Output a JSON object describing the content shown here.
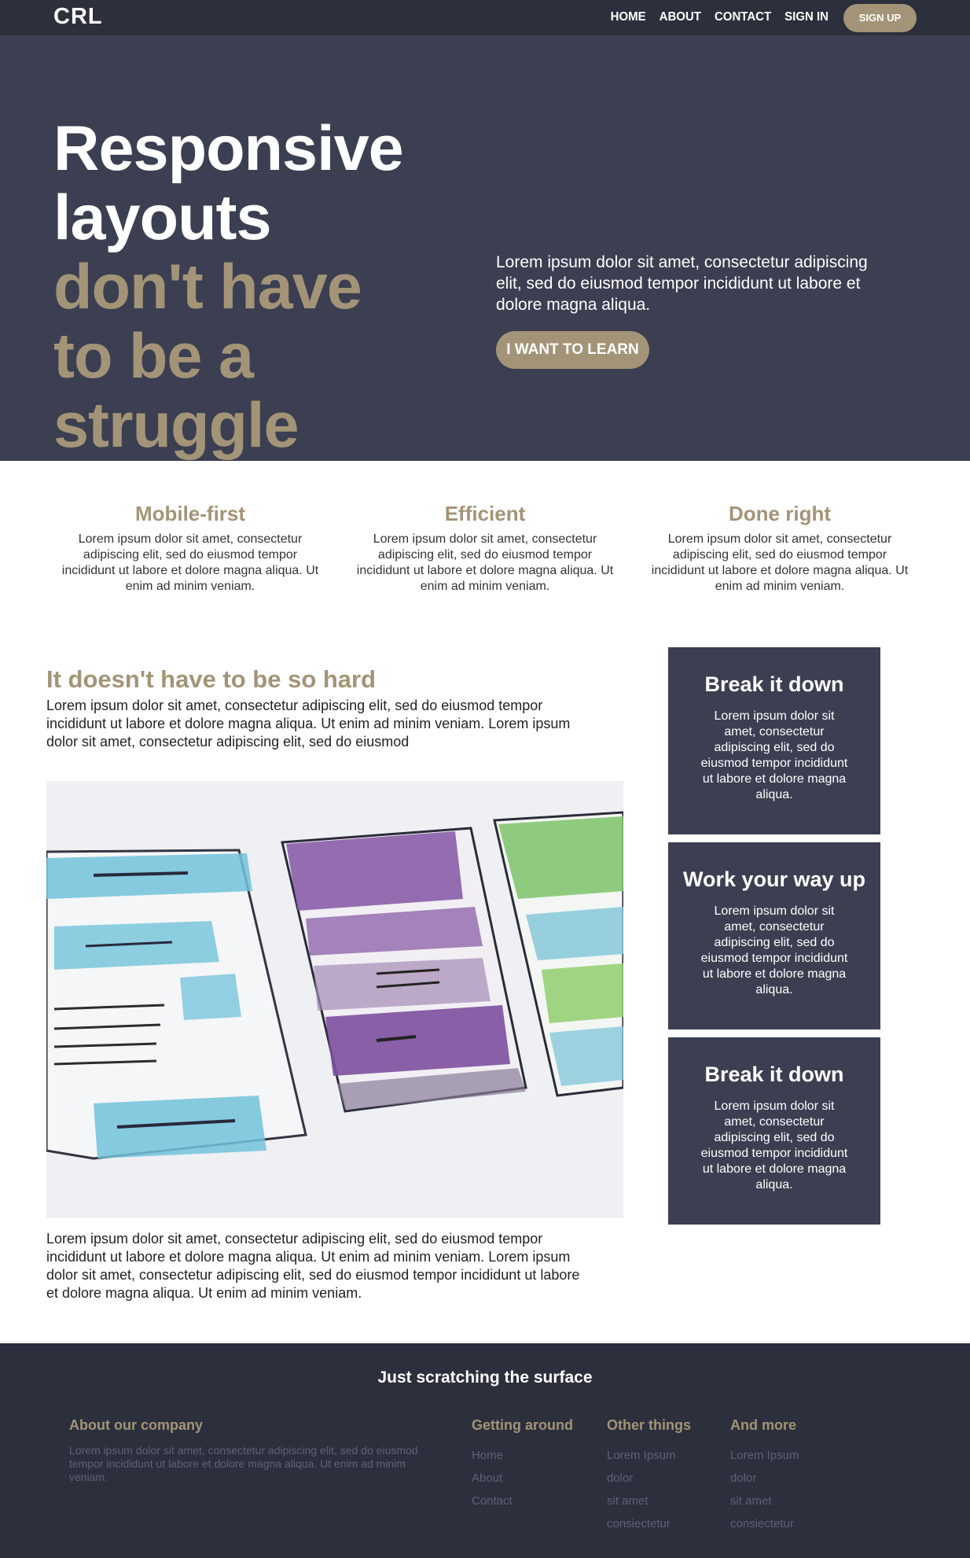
{
  "nav": {
    "logo": "CRL",
    "links": [
      "HOME",
      "ABOUT",
      "CONTACT",
      "SIGN IN"
    ],
    "signup": "SIGN UP"
  },
  "hero": {
    "title_white": "Responsive layouts",
    "title_accent": "don't have to be a struggle",
    "text": "Lorem ipsum dolor sit amet, consectetur adipiscing elit, sed do eiusmod tempor incididunt ut labore et dolore magna aliqua.",
    "button": "I WANT TO LEARN"
  },
  "features": [
    {
      "title": "Mobile-first",
      "text": "Lorem ipsum dolor sit amet, consectetur adipiscing elit, sed do eiusmod tempor incididunt ut labore et dolore magna aliqua. Ut enim ad minim veniam."
    },
    {
      "title": "Efficient",
      "text": "Lorem ipsum dolor sit amet, consectetur adipiscing elit, sed do eiusmod tempor incididunt ut labore et dolore magna aliqua. Ut enim ad minim veniam."
    },
    {
      "title": "Done right",
      "text": "Lorem ipsum dolor sit amet, consectetur adipiscing elit, sed do eiusmod tempor incididunt ut labore et dolore magna aliqua. Ut enim ad minim veniam."
    }
  ],
  "main": {
    "title": "It doesn't have to be so hard",
    "p1": "Lorem ipsum dolor sit amet, consectetur adipiscing elit, sed do eiusmod tempor incididunt ut labore et dolore magna aliqua. Ut enim ad minim veniam. Lorem ipsum dolor sit amet, consectetur adipiscing elit, sed do eiusmod",
    "p2": "Lorem ipsum dolor sit amet, consectetur adipiscing elit, sed do eiusmod tempor incididunt ut labore et dolore magna aliqua. Ut enim ad minim veniam. Lorem ipsum dolor sit amet, consectetur adipiscing elit, sed do eiusmod tempor incididunt ut labore et dolore magna aliqua. Ut enim ad minim veniam."
  },
  "cards": [
    {
      "title": "Break it down",
      "text": "Lorem ipsum dolor sit amet, consectetur adipiscing elit, sed do eiusmod tempor incididunt ut labore et dolore magna aliqua."
    },
    {
      "title": "Work your way up",
      "text": "Lorem ipsum dolor sit amet, consectetur adipiscing elit, sed do eiusmod tempor incididunt ut labore et dolore magna aliqua."
    },
    {
      "title": "Break it down",
      "text": "Lorem ipsum dolor sit amet, consectetur adipiscing elit, sed do eiusmod tempor incididunt ut labore et dolore magna aliqua."
    }
  ],
  "footer": {
    "title": "Just scratching the surface",
    "about": {
      "title": "About our company",
      "text": "Lorem ipsum dolor sit amet, consectetur adipiscing elit, sed do eiusmod tempor incididunt ut labore et dolore magna aliqua. Ut enim ad minim veniam."
    },
    "columns": [
      {
        "title": "Getting around",
        "items": [
          "Home",
          "About",
          "Contact"
        ]
      },
      {
        "title": "Other things",
        "items": [
          "Lorem Ipsum",
          "dolor",
          "sit amet",
          "consiectetur"
        ]
      },
      {
        "title": "And more",
        "items": [
          "Lorem Ipsum",
          "dolor",
          "sit amet",
          "consiectetur"
        ]
      }
    ]
  },
  "colors": {
    "accent": "#a39477",
    "hero_bg": "#3b3f51",
    "nav_bg": "#2c2f3c"
  }
}
